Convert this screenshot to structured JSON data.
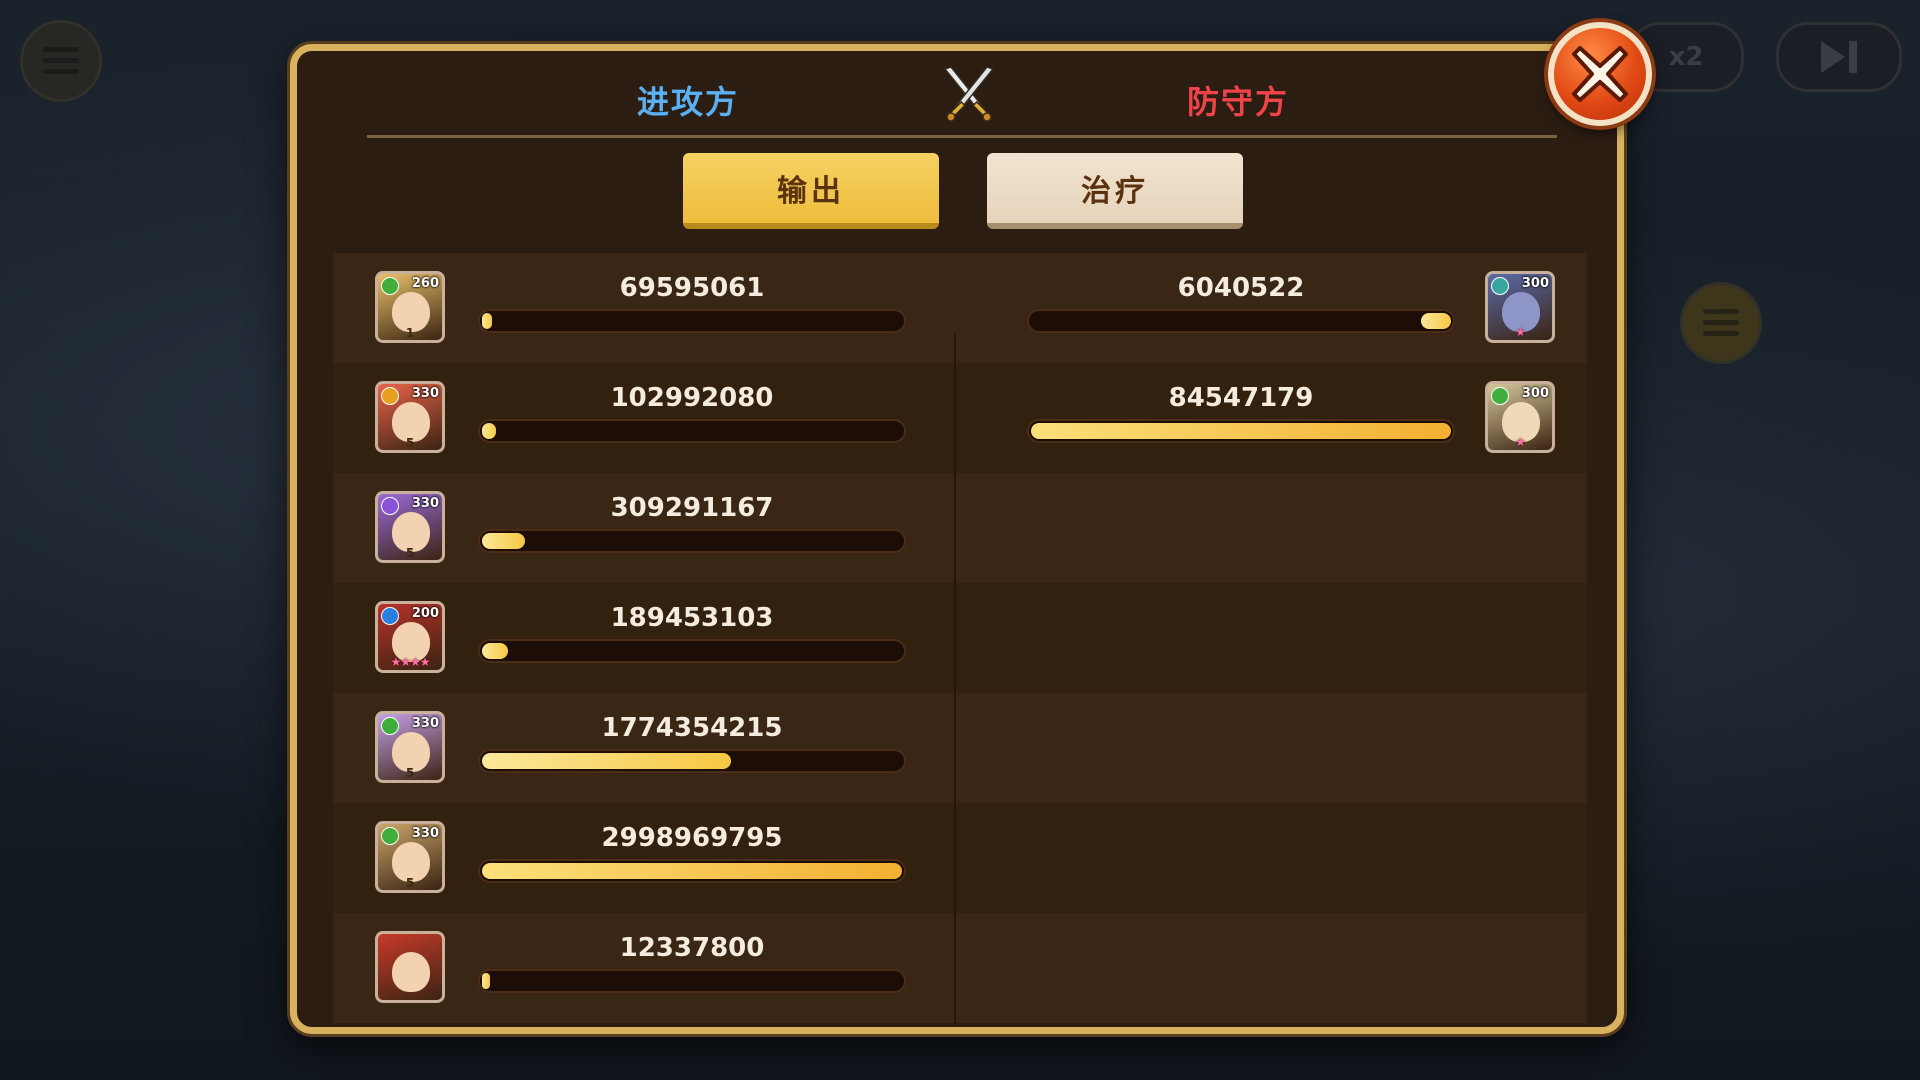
{
  "background": {
    "speed_label": "x2"
  },
  "header": {
    "attacker_label": "进攻方",
    "defender_label": "防守方"
  },
  "tabs": [
    {
      "label": "输出",
      "active": true
    },
    {
      "label": "治疗",
      "active": false
    }
  ],
  "attackers": [
    {
      "value": "69595061",
      "level": "260",
      "ratio": 0.023,
      "element": "nature",
      "rank": "1",
      "icon": "hero-portrait-icon"
    },
    {
      "value": "102992080",
      "level": "330",
      "ratio": 0.034,
      "element": "light",
      "rank": "5",
      "icon": "hero-portrait-icon"
    },
    {
      "value": "309291167",
      "level": "330",
      "ratio": 0.103,
      "element": "arcane",
      "rank": "5",
      "icon": "hero-portrait-icon"
    },
    {
      "value": "189453103",
      "level": "200",
      "ratio": 0.063,
      "element": "water",
      "rank": "★★★★",
      "icon": "hero-portrait-icon"
    },
    {
      "value": "1774354215",
      "level": "330",
      "ratio": 0.592,
      "element": "nature",
      "rank": "5",
      "icon": "hero-portrait-icon"
    },
    {
      "value": "2998969795",
      "level": "330",
      "ratio": 1.0,
      "element": "nature",
      "rank": "5",
      "icon": "hero-portrait-icon"
    },
    {
      "value": "12337800",
      "level": "",
      "ratio": 0.004,
      "element": "",
      "rank": "",
      "icon": "pet-portrait-icon"
    }
  ],
  "defenders": [
    {
      "value": "6040522",
      "level": "300",
      "ratio": 0.071,
      "element": "dark",
      "rank": "★",
      "icon": "hero-portrait-icon"
    },
    {
      "value": "84547179",
      "level": "300",
      "ratio": 1.0,
      "element": "nature",
      "rank": "★",
      "icon": "hero-portrait-icon"
    }
  ],
  "colors": {
    "attacker": "#5ab0f2",
    "defender": "#f0444a",
    "bar_fill": "#f7c845",
    "panel_border": "#d9b25e"
  }
}
